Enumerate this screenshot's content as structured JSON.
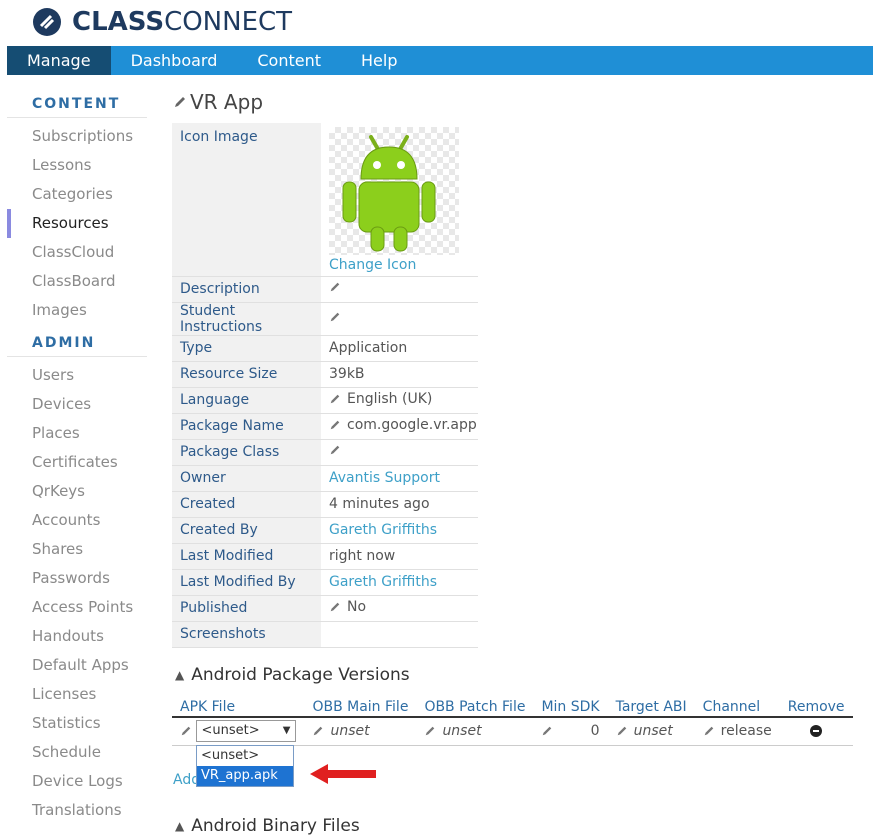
{
  "brand": {
    "name_bold": "CLASS",
    "name_regular": "CONNECT"
  },
  "nav": [
    {
      "label": "Manage",
      "active": true
    },
    {
      "label": "Dashboard"
    },
    {
      "label": "Content"
    },
    {
      "label": "Help"
    }
  ],
  "sidebar": {
    "content_heading": "CONTENT",
    "content_items": [
      "Subscriptions",
      "Lessons",
      "Categories",
      "Resources",
      "ClassCloud",
      "ClassBoard",
      "Images"
    ],
    "active_item": "Resources",
    "admin_heading": "ADMIN",
    "admin_items": [
      "Users",
      "Devices",
      "Places",
      "Certificates",
      "QrKeys",
      "Accounts",
      "Shares",
      "Passwords",
      "Access Points",
      "Handouts",
      "Default Apps",
      "Licenses",
      "Statistics",
      "Schedule",
      "Device Logs",
      "Translations"
    ]
  },
  "resource": {
    "title": "VR App",
    "icon_label": "Icon Image",
    "change_icon": "Change Icon",
    "rows": [
      {
        "label": "Description",
        "value": "",
        "editable": true
      },
      {
        "label": "Student Instructions",
        "value": "",
        "editable": true
      },
      {
        "label": "Type",
        "value": "Application"
      },
      {
        "label": "Resource Size",
        "value": "39kB"
      },
      {
        "label": "Language",
        "value": "English (UK)",
        "editable": true
      },
      {
        "label": "Package Name",
        "value": "com.google.vr.app",
        "editable": true
      },
      {
        "label": "Package Class",
        "value": "",
        "editable": true
      },
      {
        "label": "Owner",
        "value": "Avantis Support",
        "link": true
      },
      {
        "label": "Created",
        "value": "4 minutes ago"
      },
      {
        "label": "Created By",
        "value": "Gareth Griffiths",
        "link": true
      },
      {
        "label": "Last Modified",
        "value": "right now"
      },
      {
        "label": "Last Modified By",
        "value": "Gareth Griffiths",
        "link": true
      },
      {
        "label": "Published",
        "value": "No",
        "editable": true
      },
      {
        "label": "Screenshots",
        "value": ""
      }
    ]
  },
  "apk_section": {
    "title": "Android Package Versions",
    "columns": [
      "APK File",
      "OBB Main File",
      "OBB Patch File",
      "Min SDK",
      "Target ABI",
      "Channel",
      "Remove"
    ],
    "row": {
      "apk_selected": "<unset>",
      "obb_main": "unset",
      "obb_patch": "unset",
      "min_sdk": "0",
      "target_abi": "unset",
      "channel": "release"
    },
    "dropdown_options": [
      "<unset>",
      "VR_app.apk"
    ],
    "dropdown_highlighted": "VR_app.apk",
    "add_link": "Add"
  },
  "binary_section": {
    "title": "Android Binary Files"
  },
  "colors": {
    "nav_bg": "#1f8fd6",
    "nav_active": "#154d73",
    "arrow": "#e02020"
  }
}
